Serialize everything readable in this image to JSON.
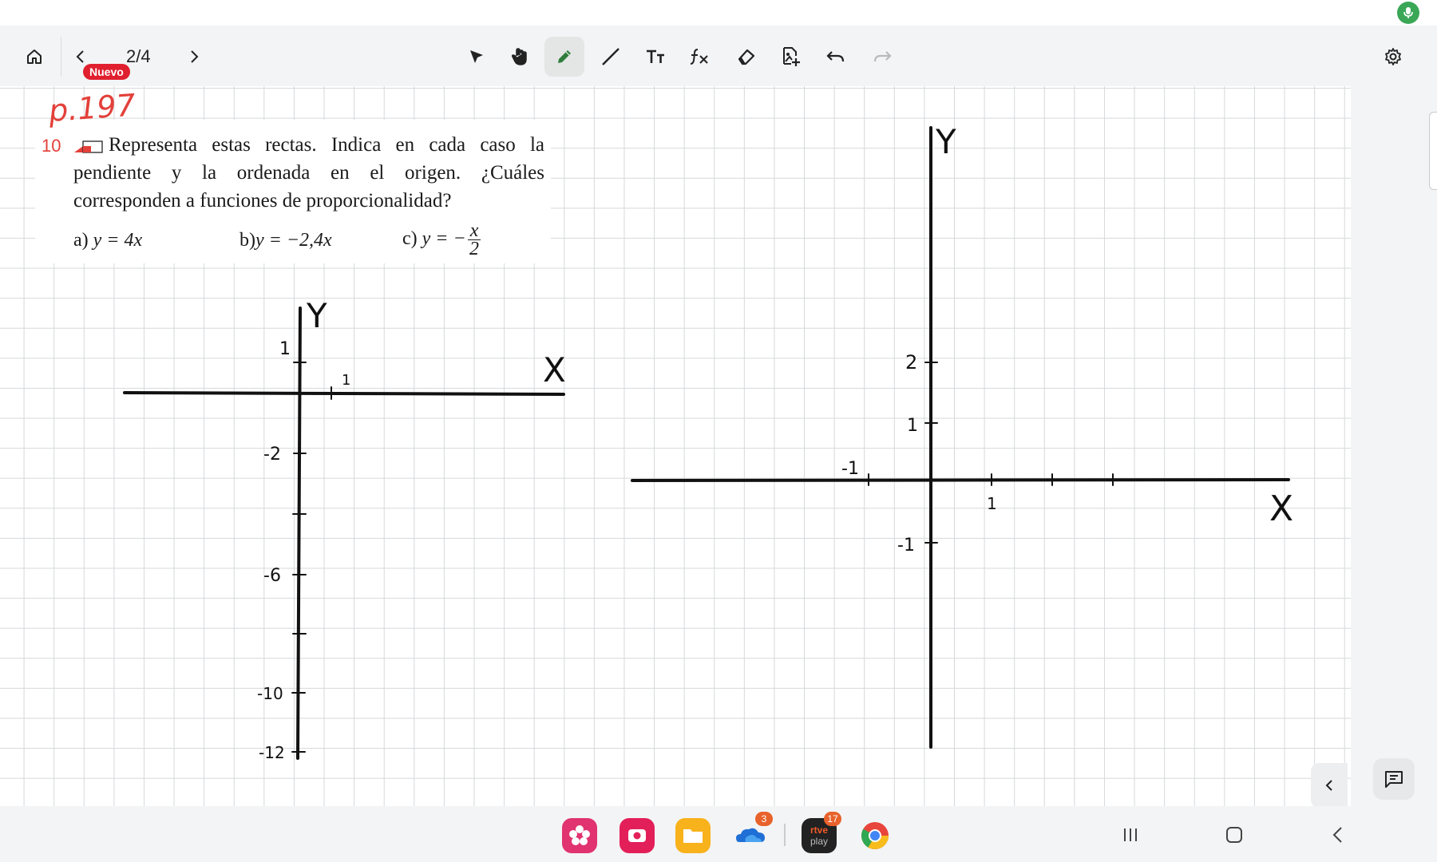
{
  "toolbar": {
    "badge": "Nuevo",
    "page_indicator": "2/4",
    "tools": [
      "select",
      "hand",
      "pen",
      "line",
      "text",
      "formula",
      "eraser",
      "insert-image",
      "undo",
      "redo"
    ],
    "active_tool": "pen",
    "accent": "#3aa757"
  },
  "handwriting": {
    "page_ref": "p.197"
  },
  "exercise": {
    "number": "10",
    "text": "Representa estas rectas. Indica en cada caso la pendiente y la ordenada en el origen. ¿Cuáles corresponden a funciones de proporcionalidad?",
    "opt_a_label": "a)",
    "opt_a_eq": "y = 4x",
    "opt_b_label": "b)",
    "opt_b_eq": "y = −2,4x",
    "opt_c_label": "c)",
    "opt_c_eq": "y = −",
    "opt_c_num": "x",
    "opt_c_den": "2",
    "number_color": "#e3403a"
  },
  "graph_left": {
    "x_label": "X",
    "y_label": "Y",
    "x_ticks": [
      "1"
    ],
    "y_ticks": [
      "1",
      "-2",
      "-6",
      "-10",
      "-12"
    ]
  },
  "graph_right": {
    "x_label": "X",
    "y_label": "Y",
    "x_ticks": [
      "-1",
      "1"
    ],
    "y_ticks": [
      "2",
      "1",
      "-1"
    ]
  },
  "dock": {
    "apps": [
      {
        "name": "blossom"
      },
      {
        "name": "camera"
      },
      {
        "name": "files"
      },
      {
        "name": "onedrive",
        "badge": "3"
      },
      {
        "name": "rtve-play",
        "badge": "17",
        "label_top": "rtve",
        "label_bottom": "play"
      },
      {
        "name": "chrome"
      }
    ]
  }
}
